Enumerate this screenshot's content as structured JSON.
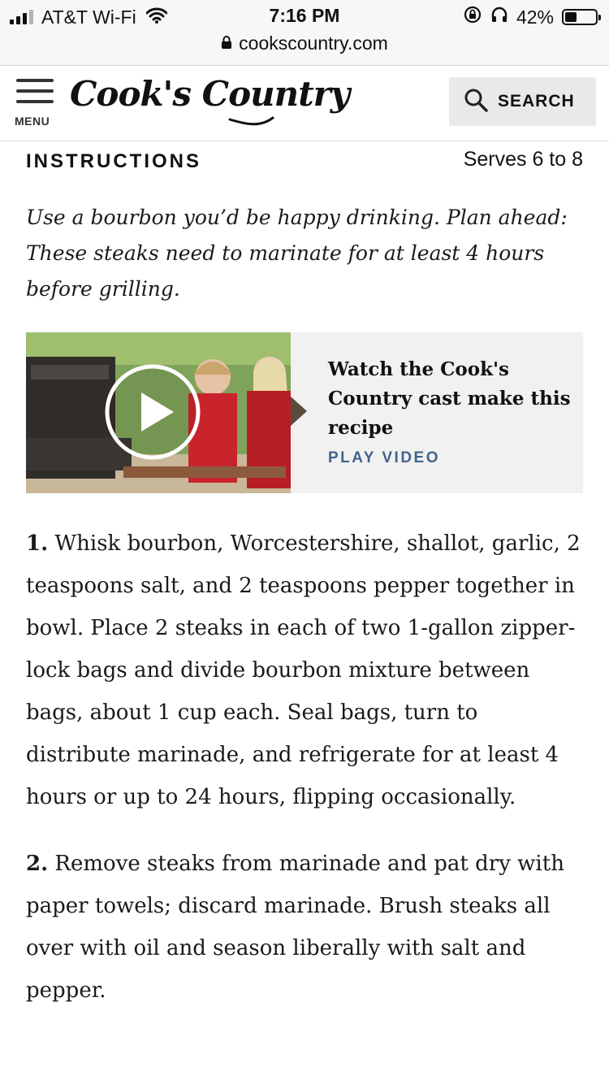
{
  "status_bar": {
    "carrier": "AT&T Wi-Fi",
    "time": "7:16 PM",
    "battery": "42%",
    "battery_level": 0.42,
    "url": "cookscountry.com"
  },
  "header": {
    "menu_label": "MENU",
    "logo": "Cook's Country",
    "search_label": "SEARCH"
  },
  "instructions": {
    "title": "INSTRUCTIONS",
    "serves": "Serves 6 to 8",
    "note": "Use a bourbon you’d be happy drinking. Plan ahead: These steaks need to marinate for at least 4 hours before grilling."
  },
  "video": {
    "title": "Watch the Cook's Country cast make this recipe",
    "cta": "PLAY VIDEO"
  },
  "steps": [
    {
      "number": "1.",
      "text": "Whisk bourbon, Worcestershire, shallot, garlic, 2 teaspoons salt, and 2 teaspoons pepper together in bowl. Place 2 steaks in each of two 1-gallon zipper-lock bags and divide bourbon mixture between bags, about 1 cup each. Seal bags, turn to distribute marinade, and refrigerate for at least 4 hours or up to 24 hours, flipping occasionally."
    },
    {
      "number": "2.",
      "text": "Remove steaks from marinade and pat dry with paper towels; discard marinade. Brush steaks all over with oil and season liberally with salt and pepper."
    }
  ],
  "icons": {
    "signal": "cellular-signal-icon",
    "wifi": "wifi-icon",
    "orientation_lock": "orientation-lock-icon",
    "headphones": "headphones-icon",
    "battery": "battery-icon",
    "lock": "lock-icon",
    "menu": "hamburger-menu-icon",
    "search": "search-icon",
    "play": "play-icon"
  },
  "colors": {
    "accent": "#43638c",
    "video_card_bg": "#f1f1f1",
    "search_button_bg": "#e9e9e9"
  }
}
